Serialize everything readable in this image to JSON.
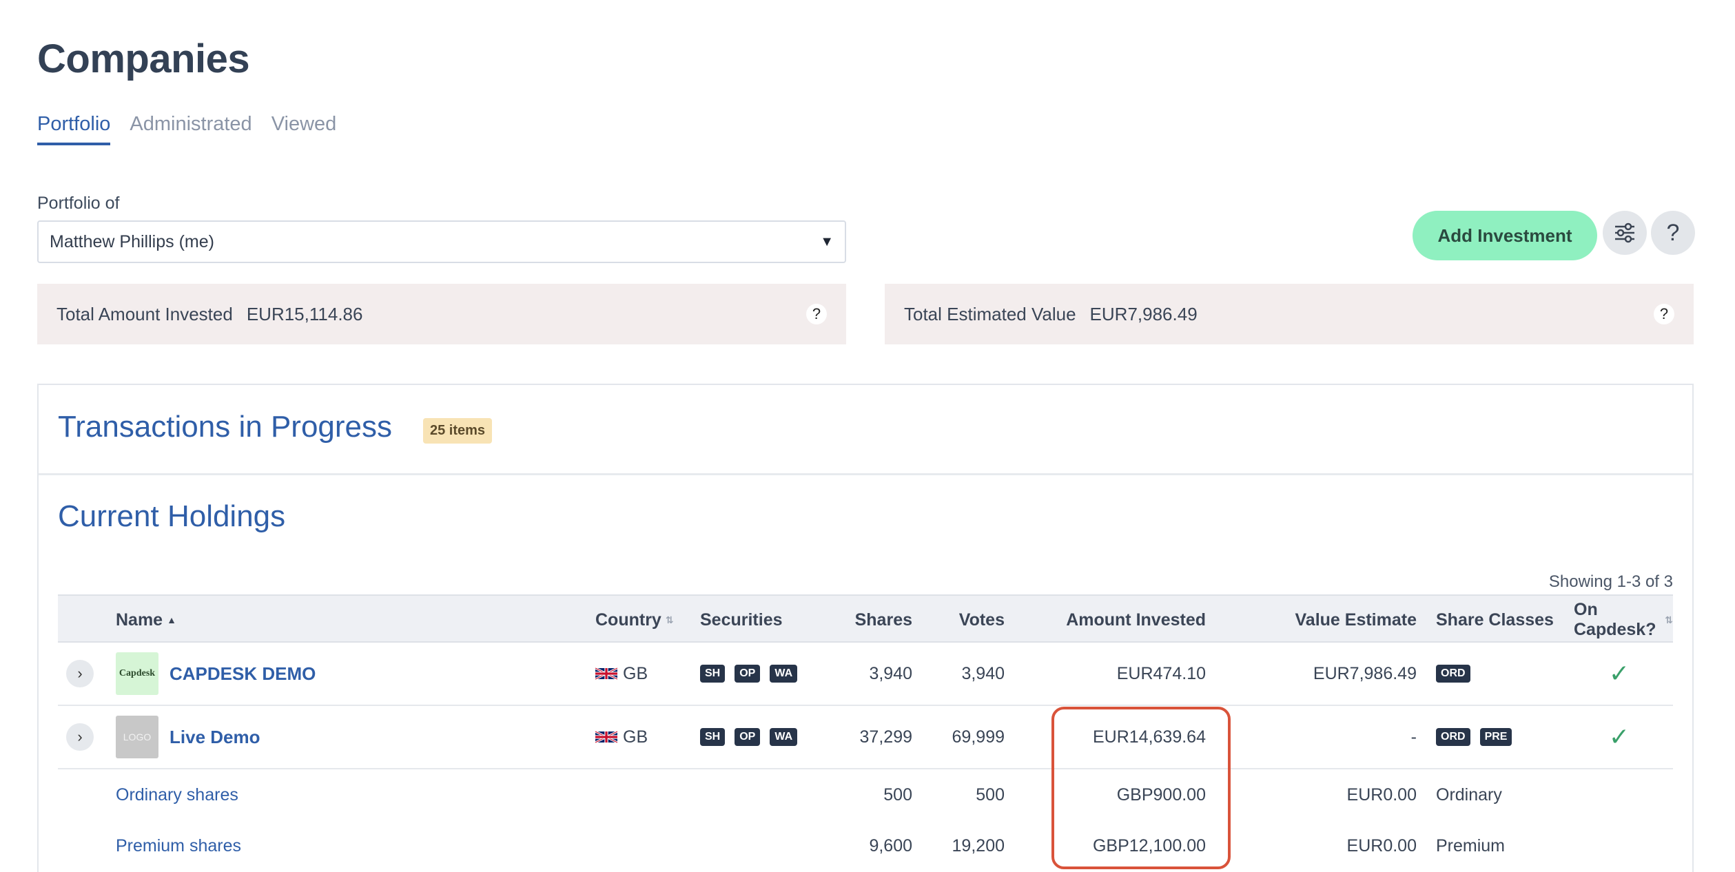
{
  "page": {
    "title": "Companies"
  },
  "tabs": [
    {
      "label": "Portfolio",
      "active": true
    },
    {
      "label": "Administrated",
      "active": false
    },
    {
      "label": "Viewed",
      "active": false
    }
  ],
  "portfolio": {
    "label": "Portfolio of",
    "selected": "Matthew Phillips (me)"
  },
  "actions": {
    "add_investment": "Add Investment",
    "filters_icon": "sliders-icon",
    "help": "?"
  },
  "summary": {
    "invested_label": "Total Amount Invested",
    "invested_value": "EUR15,114.86",
    "estimated_label": "Total Estimated Value",
    "estimated_value": "EUR7,986.49",
    "help": "?"
  },
  "transactions": {
    "title": "Transactions in Progress",
    "badge": "25 items"
  },
  "holdings": {
    "title": "Current Holdings",
    "showing": "Showing 1-3 of 3",
    "columns": {
      "name": "Name",
      "country": "Country",
      "securities": "Securities",
      "shares": "Shares",
      "votes": "Votes",
      "amount": "Amount Invested",
      "value": "Value Estimate",
      "classes": "Share Classes",
      "capdesk": "On Capdesk?"
    },
    "rows": [
      {
        "logo_text": "Capdesk",
        "name": "CAPDESK DEMO",
        "country": "GB",
        "securities": [
          "SH",
          "OP",
          "WA"
        ],
        "shares": "3,940",
        "votes": "3,940",
        "amount": "EUR474.10",
        "value": "EUR7,986.49",
        "classes": [
          "ORD"
        ],
        "on_capdesk": "✓"
      },
      {
        "logo_text": "LOGO",
        "name": "Live Demo",
        "country": "GB",
        "securities": [
          "SH",
          "OP",
          "WA"
        ],
        "shares": "37,299",
        "votes": "69,999",
        "amount": "EUR14,639.64",
        "value": "-",
        "classes": [
          "ORD",
          "PRE"
        ],
        "on_capdesk": "✓"
      }
    ],
    "subrows": [
      {
        "name": "Ordinary shares",
        "shares": "500",
        "votes": "500",
        "amount": "GBP900.00",
        "value": "EUR0.00",
        "class": "Ordinary"
      },
      {
        "name": "Premium shares",
        "shares": "9,600",
        "votes": "19,200",
        "amount": "GBP12,100.00",
        "value": "EUR0.00",
        "class": "Premium"
      }
    ]
  },
  "colors": {
    "accent": "#2f5ea8",
    "add_button": "#8ff0c0",
    "summary_bg": "#f3eded",
    "highlight": "#d9533a"
  }
}
